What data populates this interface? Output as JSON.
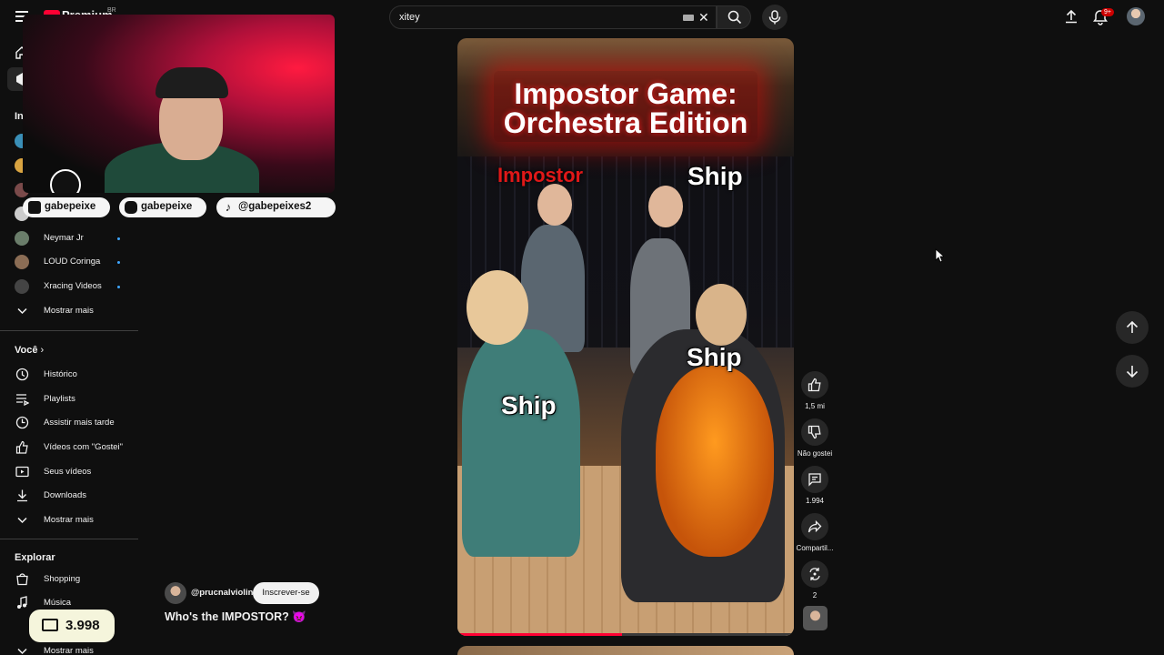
{
  "header": {
    "logo_text": "Premium",
    "country": "BR",
    "search_value": "xitey",
    "notification_count": "9+"
  },
  "sidebar": {
    "subscriptions_heading": "In",
    "subscriptions": [
      {
        "label": "Neymar Jr",
        "avatar_color": "#6a7d6a"
      },
      {
        "label": "LOUD Coringa",
        "avatar_color": "#8b6d55"
      },
      {
        "label": "Xracing Videos",
        "avatar_color": "#444444"
      }
    ],
    "subscriptions_more": "Mostrar mais",
    "you_heading": "Você",
    "you_items": [
      {
        "label": "Histórico",
        "icon": "history-icon"
      },
      {
        "label": "Playlists",
        "icon": "playlists-icon"
      },
      {
        "label": "Assistir mais tarde",
        "icon": "clock-icon"
      },
      {
        "label": "Vídeos com \"Gostei\"",
        "icon": "thumb-up-icon"
      },
      {
        "label": "Seus vídeos",
        "icon": "video-icon"
      },
      {
        "label": "Downloads",
        "icon": "download-icon"
      },
      {
        "label": "Mostrar mais",
        "icon": "chevron-down-icon"
      }
    ],
    "explore_heading": "Explorar",
    "explore_items": [
      {
        "label": "Shopping",
        "icon": "shopping-bag-icon"
      },
      {
        "label": "Música",
        "icon": "music-note-icon"
      },
      {
        "label": "Mostrar mais",
        "icon": "chevron-down-icon"
      }
    ]
  },
  "stream_overlay": {
    "socials": [
      {
        "label": "gabepeixe",
        "icon": "youtube-icon"
      },
      {
        "label": "gabepeixe",
        "icon": "instagram-icon"
      },
      {
        "label": "@gabepeixes2",
        "icon": "tiktok-icon"
      }
    ],
    "ticket_count": "3.998"
  },
  "short": {
    "title_line1": "Impostor Game:",
    "title_line2": "Orchestra Edition",
    "label_impostor": "Impostor",
    "label_ship": "Ship",
    "channel": "@prucnalviolin",
    "subscribe_label": "Inscrever-se",
    "caption": "Who's the IMPOSTOR? 👿",
    "progress": 0.49
  },
  "actions": {
    "likes": "1,5 mi",
    "dislike_label": "Não gostei",
    "comments": "1.994",
    "share_label": "Compartil...",
    "remix_count": "2"
  },
  "colors": {
    "accent_red": "#ff0033",
    "background": "#0f0f0f",
    "surface": "#272727"
  }
}
